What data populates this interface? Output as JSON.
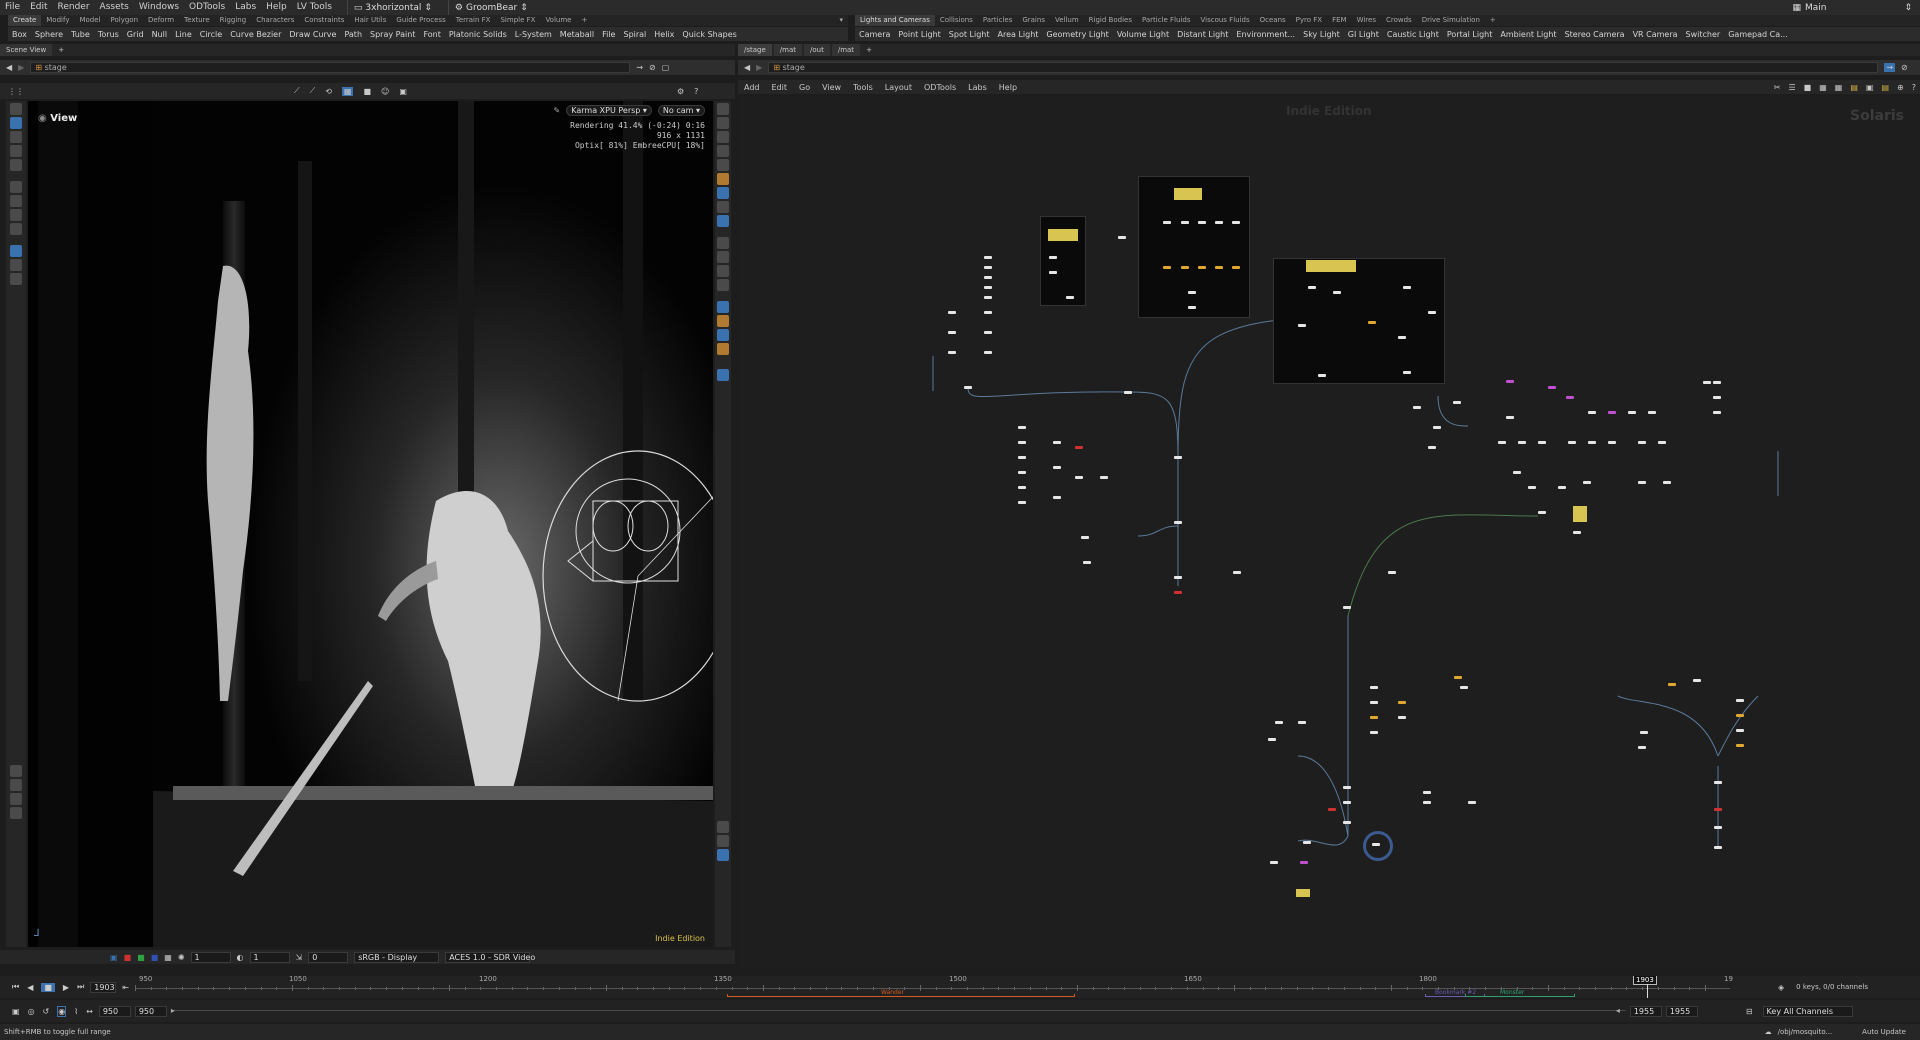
{
  "menubar": {
    "items": [
      "File",
      "Edit",
      "Render",
      "Assets",
      "Windows",
      "ODTools",
      "Labs",
      "Help",
      "LV Tools"
    ],
    "desktop": "3xhorizontal",
    "context": "GroomBear",
    "main": "Main"
  },
  "shelf_left": [
    "Create",
    "Modify",
    "Model",
    "Polygon",
    "Deform",
    "Texture",
    "Rigging",
    "Characters",
    "Constraints",
    "Hair Utils",
    "Guide Process",
    "Terrain FX",
    "Simple FX",
    "Volume"
  ],
  "shelf_right": [
    "Lights and Cameras",
    "Collisions",
    "Particles",
    "Grains",
    "Vellum",
    "Rigid Bodies",
    "Particle Fluids",
    "Viscous Fluids",
    "Oceans",
    "Pyro FX",
    "FEM",
    "Wires",
    "Crowds",
    "Drive Simulation"
  ],
  "tools_left": [
    "Box",
    "Sphere",
    "Tube",
    "Torus",
    "Grid",
    "Null",
    "Line",
    "Circle",
    "Curve Bezier",
    "Draw Curve",
    "Path",
    "Spray Paint",
    "Font",
    "Platonic Solids",
    "L-System",
    "Metaball",
    "File",
    "Spiral",
    "Helix",
    "Quick Shapes"
  ],
  "tools_right": [
    "Camera",
    "Point Light",
    "Spot Light",
    "Area Light",
    "Geometry Light",
    "Volume Light",
    "Distant Light",
    "Environment...",
    "Sky Light",
    "GI Light",
    "Caustic Light",
    "Portal Light",
    "Ambient Light",
    "Stereo Camera",
    "VR Camera",
    "Switcher",
    "Gamepad Ca..."
  ],
  "left_panel": {
    "tab": "Scene View",
    "path": "stage",
    "view_label": "View",
    "renderer": "Karma XPU",
    "persp": "Persp",
    "cam": "No cam",
    "stats": [
      "Rendering  41.4%  (-0:24)  0:16",
      "916 x 1131",
      "Optix[ 81%] EmbreeCPU[ 18%]"
    ],
    "watermark": "Indie Edition",
    "bottom": {
      "v1": "1",
      "v2": "1",
      "v3": "0",
      "display": "sRGB - Display",
      "view": "ACES 1.0 - SDR Video"
    }
  },
  "right_panel": {
    "tabs": [
      "/stage",
      "/mat",
      "/out",
      "/mat"
    ],
    "path": "stage",
    "menu": [
      "Add",
      "Edit",
      "Go",
      "View",
      "Tools",
      "Layout",
      "ODTools",
      "Labs",
      "Help"
    ],
    "watermark": "Indie Edition",
    "context_label": "Solaris"
  },
  "timeline": {
    "frame": "1903",
    "ticks": [
      "950",
      "1050",
      "1200",
      "1350",
      "1500",
      "1650",
      "1800",
      "19"
    ],
    "range_start": "950",
    "range_start2": "950",
    "range_end": "1955",
    "range_end2": "1955",
    "marker_label": "1903",
    "bookmark_orange": "Wander",
    "bookmark_purple": "Bookmark #2",
    "bookmark_green": "Monster",
    "keys": "0 keys, 0/0 channels",
    "key_all": "Key All Channels"
  },
  "status": {
    "hint": "Shift+RMB to toggle full range",
    "path": "/obj/mosquito...",
    "update": "Auto Update"
  }
}
